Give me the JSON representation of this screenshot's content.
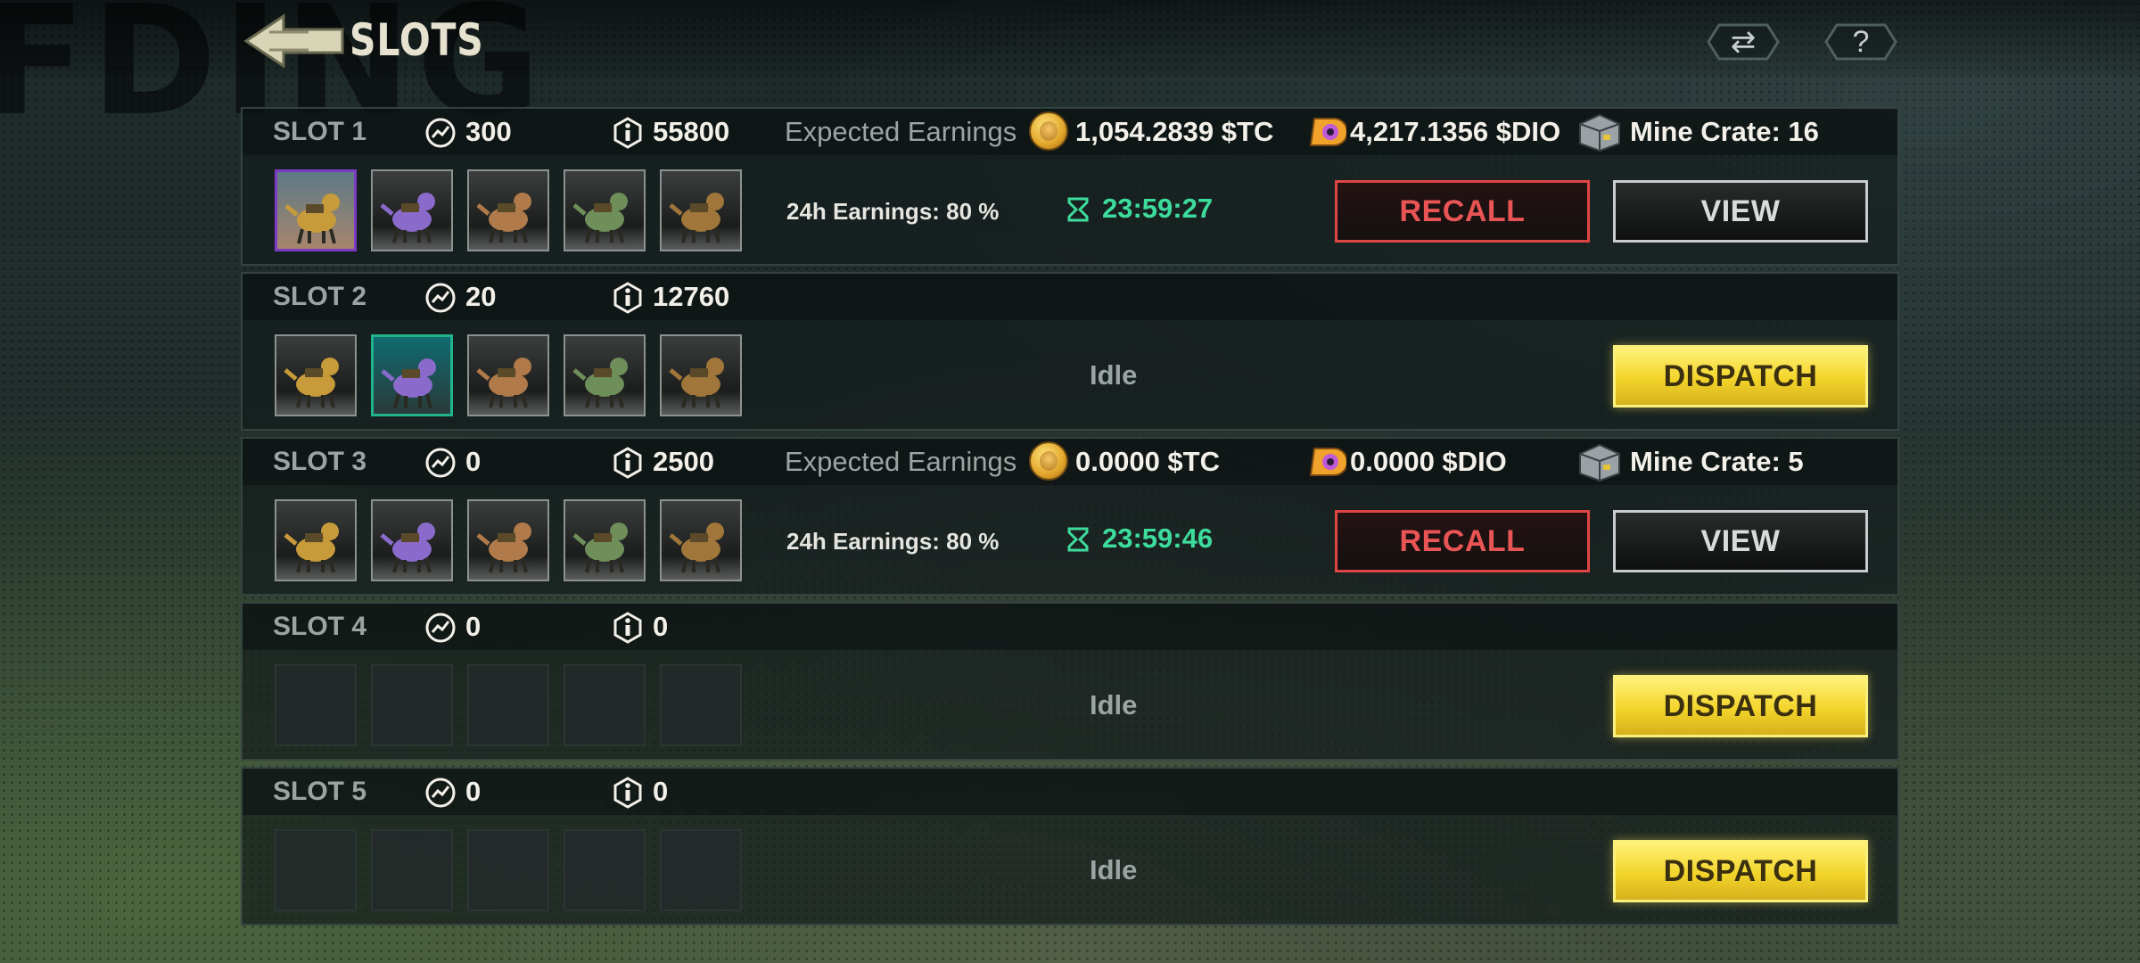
{
  "header": {
    "title": "SLOTS",
    "background_text": "FDING"
  },
  "colors": {
    "dispatch": "#f3d42a",
    "recall": "#e04545",
    "timer": "#3ddc9c"
  },
  "top_buttons": [
    {
      "icon": "swap-icon",
      "glyph": "⇄"
    },
    {
      "icon": "help-icon",
      "glyph": "?"
    }
  ],
  "slots": [
    {
      "name": "SLOT 1",
      "power": "300",
      "value": "55800",
      "status": "active",
      "expected_label": "Expected Earnings",
      "tc": "1,054.2839 $TC",
      "dio": "4,217.1356 $DIO",
      "crate": "Mine Crate: 16",
      "earnings_24h": "24h Earnings: 80 %",
      "timer": "23:59:27",
      "recall": "RECALL",
      "view": "VIEW",
      "thumbs": [
        "purple",
        "normal",
        "normal",
        "normal",
        "normal"
      ]
    },
    {
      "name": "SLOT 2",
      "power": "20",
      "value": "12760",
      "status": "idle",
      "idle": "Idle",
      "dispatch": "DISPATCH",
      "thumbs": [
        "normal",
        "green",
        "normal",
        "normal",
        "normal"
      ]
    },
    {
      "name": "SLOT 3",
      "power": "0",
      "value": "2500",
      "status": "active",
      "expected_label": "Expected Earnings",
      "tc": "0.0000 $TC",
      "dio": "0.0000 $DIO",
      "crate": "Mine Crate: 5",
      "earnings_24h": "24h Earnings: 80 %",
      "timer": "23:59:46",
      "recall": "RECALL",
      "view": "VIEW",
      "thumbs": [
        "normal",
        "normal",
        "normal",
        "normal",
        "normal"
      ]
    },
    {
      "name": "SLOT 4",
      "power": "0",
      "value": "0",
      "status": "idle",
      "idle": "Idle",
      "dispatch": "DISPATCH",
      "thumbs": [
        "empty",
        "empty",
        "empty",
        "empty",
        "empty"
      ]
    },
    {
      "name": "SLOT 5",
      "power": "0",
      "value": "0",
      "status": "idle",
      "idle": "Idle",
      "dispatch": "DISPATCH",
      "thumbs": [
        "empty",
        "empty",
        "empty",
        "empty",
        "empty"
      ]
    }
  ]
}
